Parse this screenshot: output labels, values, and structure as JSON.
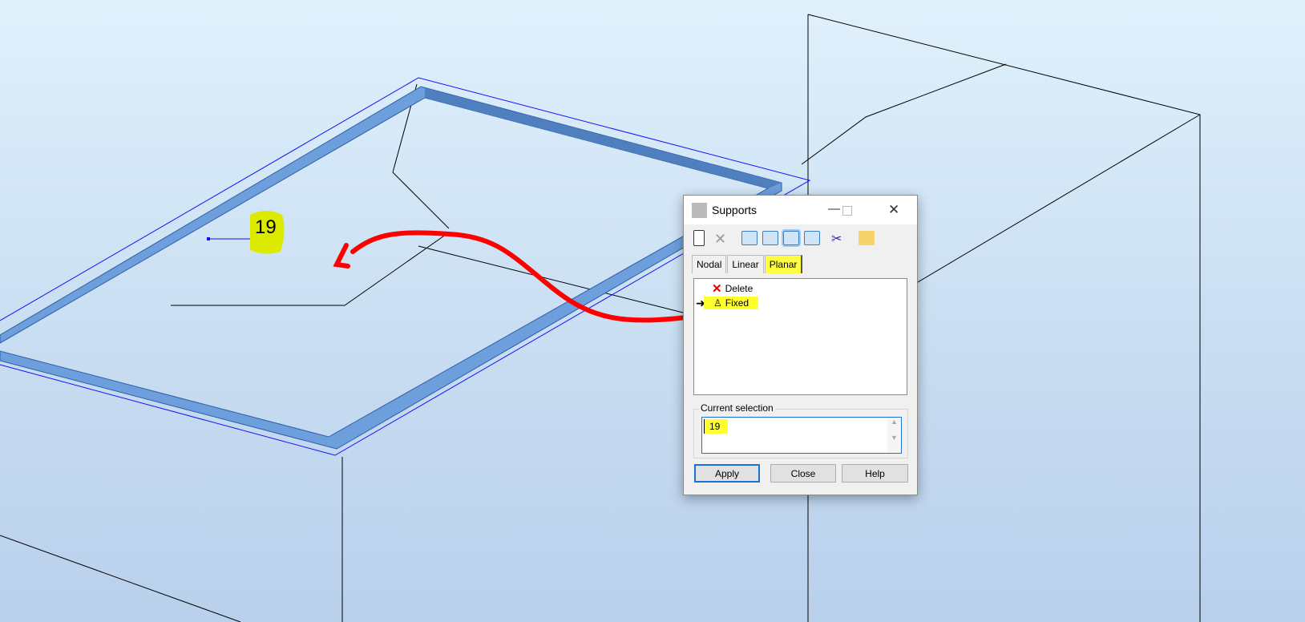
{
  "viewport": {
    "node_label": "19"
  },
  "dialog": {
    "title": "Supports",
    "toolbar": [
      "new-icon",
      "delete-icon",
      "view-1-icon",
      "view-2-icon",
      "view-3-icon",
      "view-4-icon",
      "cut-icon",
      "open-folder-icon"
    ],
    "tabs": [
      {
        "label": "Nodal"
      },
      {
        "label": "Linear"
      },
      {
        "label": "Planar",
        "active": true
      }
    ],
    "list": [
      {
        "label": "Delete"
      },
      {
        "label": "Fixed",
        "current": true
      }
    ],
    "selection_label": "Current selection",
    "selection_value": "19",
    "buttons": {
      "apply": "Apply",
      "close": "Close",
      "help": "Help"
    }
  },
  "colors": {
    "highlight": "#ffff00",
    "annotation": "#ff0000",
    "beam": "#6d9fdc"
  }
}
